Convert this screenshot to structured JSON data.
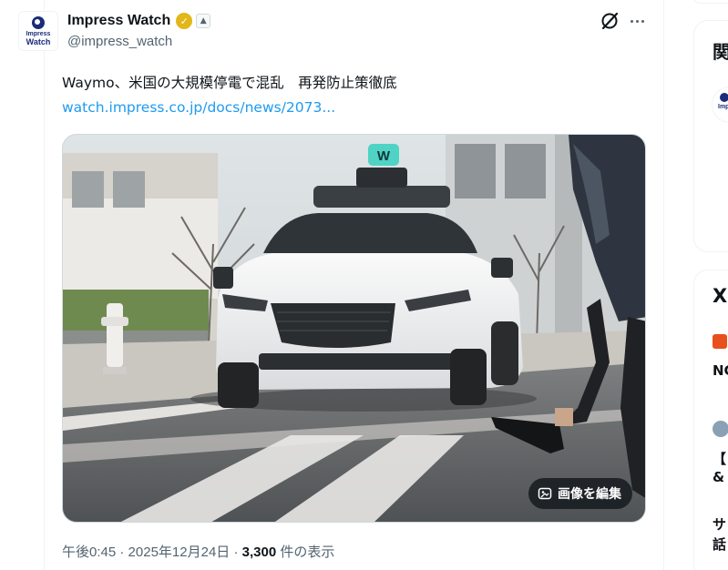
{
  "tweet": {
    "display_name": "Impress Watch",
    "handle": "@impress_watch",
    "avatar_line1": "Impress",
    "avatar_line2": "Watch",
    "icons": [
      "verified-badge-icon",
      "affiliate-badge-icon",
      "grok-icon",
      "more-icon"
    ],
    "text": "Waymo、米国の大規模停電で混乱　再発防止策徹底 ",
    "link": "watch.impress.co.jp/docs/news/2073...",
    "media_action": "画像を編集",
    "time": "午後0:45",
    "date": "2025年12月24日",
    "views_count": "3,300",
    "views_label": " 件の表示",
    "separator": " · "
  },
  "right_panel": {
    "section_title_char": "関",
    "logo_text": "Impr W",
    "trend_title": "X",
    "item_label": "NC",
    "line_a": "【",
    "line_b": "&",
    "line_c": "サ",
    "line_d": "話"
  },
  "colors": {
    "accent_link": "#1d9bf0",
    "verified_gold": "#e2b719",
    "secondary_text": "#536471"
  }
}
